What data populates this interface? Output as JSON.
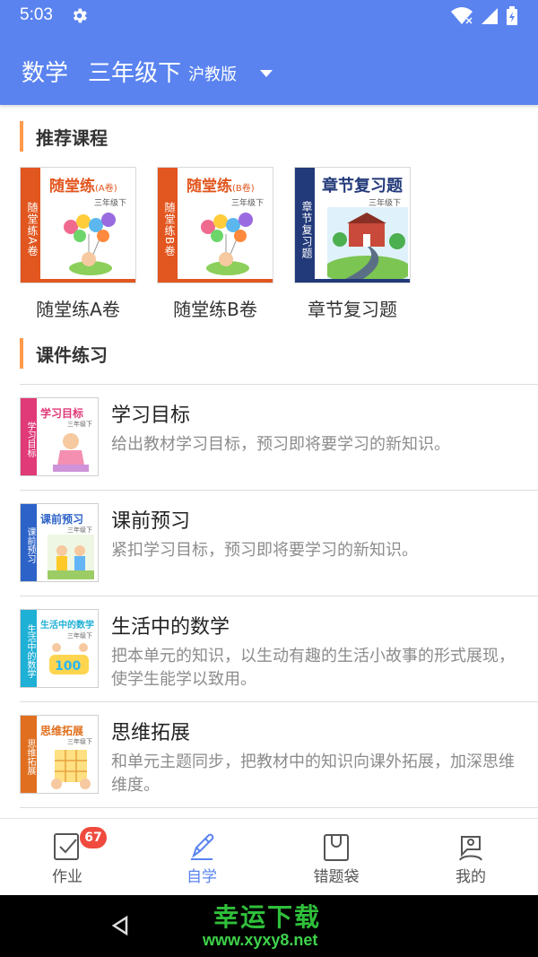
{
  "status_bar": {
    "time": "5:03"
  },
  "app_bar": {
    "subject": "数学",
    "grade": "三年级下",
    "edition": "沪教版"
  },
  "sections": {
    "recommended": "推荐课程",
    "courseware": "课件练习"
  },
  "recommended": [
    {
      "label": "随堂练A卷",
      "cover_title": "随堂练",
      "cover_tag": "(A卷)",
      "cover_side": "随堂练A卷",
      "cover_grade": "三年级下",
      "color": "#e2561f"
    },
    {
      "label": "随堂练B卷",
      "cover_title": "随堂练",
      "cover_tag": "(B卷)",
      "cover_side": "随堂练B卷",
      "cover_grade": "三年级下",
      "color": "#e2561f"
    },
    {
      "label": "章节复习题",
      "cover_title": "章节复习题",
      "cover_tag": "",
      "cover_side": "章节复习题",
      "cover_grade": "三年级下",
      "color": "#233a7a"
    }
  ],
  "courseware": [
    {
      "title": "学习目标",
      "desc": "给出教材学习目标，预习即将要学习的新知识。",
      "thumb_title": "学习目标",
      "thumb_side": "学习目标",
      "thumb_grade": "三年级下",
      "color": "#e03a78"
    },
    {
      "title": "课前预习",
      "desc": "紧扣学习目标，预习即将要学习的新知识。",
      "thumb_title": "课前预习",
      "thumb_side": "课前预习",
      "thumb_grade": "三年级下",
      "color": "#2d63c8"
    },
    {
      "title": "生活中的数学",
      "desc": "把本单元的知识，以生动有趣的生活小故事的形式展现，使学生能学以致用。",
      "thumb_title": "生活中的数学",
      "thumb_side": "生活中的数学",
      "thumb_grade": "三年级下",
      "color": "#1fb0d6"
    },
    {
      "title": "思维拓展",
      "desc": "和单元主题同步，把教材中的知识向课外拓展，加深思维维度。",
      "thumb_title": "思维拓展",
      "thumb_side": "思维拓展",
      "thumb_grade": "三年级下",
      "color": "#e0701f"
    }
  ],
  "bottom_nav": [
    {
      "label": "作业",
      "icon": "homework-icon",
      "badge": "67"
    },
    {
      "label": "自学",
      "icon": "pencil-icon",
      "active": true
    },
    {
      "label": "错题袋",
      "icon": "bag-icon"
    },
    {
      "label": "我的",
      "icon": "profile-icon"
    }
  ],
  "watermark": {
    "title": "幸运下载",
    "url": "www.xyxy8.net"
  },
  "colors": {
    "primary": "#5a83f0",
    "accent": "#ff9a4d",
    "badge": "#f04a3e"
  }
}
